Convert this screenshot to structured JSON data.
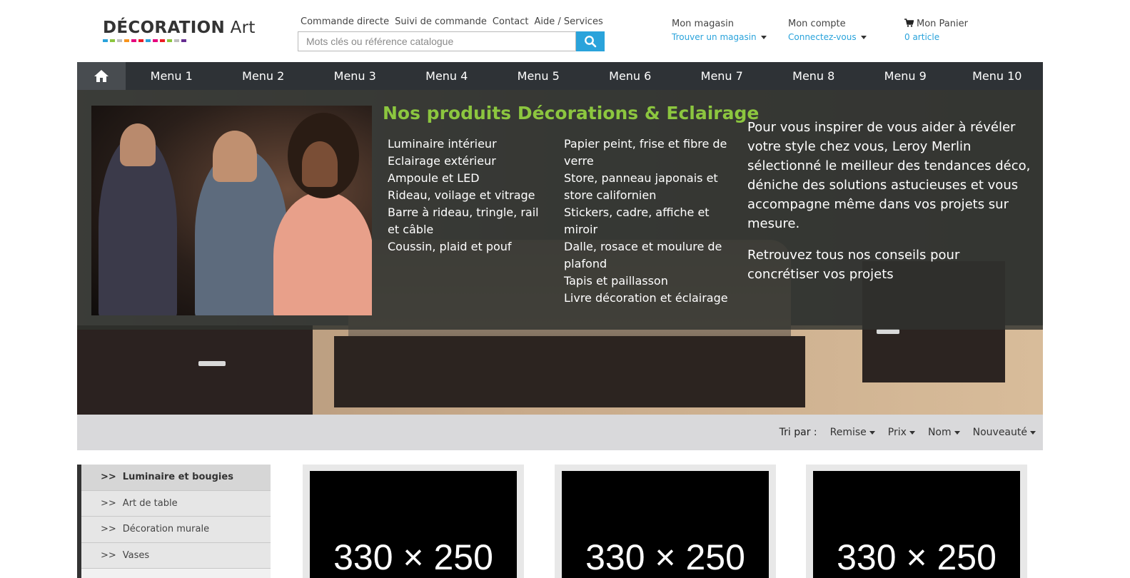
{
  "logo": {
    "brand": "DÉCORATION",
    "suffix": "Art",
    "bar_colors": [
      "#2aa3db",
      "#8cc63f",
      "#bfbfbf",
      "#f7941d",
      "#e6007e",
      "#ec1c24",
      "#2aa3db",
      "#e6007e",
      "#ec1c24",
      "#8cc63f",
      "#bfbfbf",
      "#662d91"
    ]
  },
  "toplinks": [
    "Commande directe",
    "Suivi de commande",
    "Contact",
    "Aide / Services"
  ],
  "search": {
    "placeholder": "Mots clés ou référence catalogue",
    "button_icon": "search-icon"
  },
  "header": {
    "store": {
      "title": "Mon magasin",
      "link": "Trouver un magasin"
    },
    "account": {
      "title": "Mon compte",
      "link": "Connectez-vous"
    },
    "cart": {
      "title": "Mon Panier",
      "count": "0 article",
      "icon": "cart-icon"
    }
  },
  "nav": {
    "home_icon": "home-icon",
    "items": [
      "Menu 1",
      "Menu 2",
      "Menu 3",
      "Menu 4",
      "Menu 5",
      "Menu 6",
      "Menu 7",
      "Menu 8",
      "Menu 9",
      "Menu 10"
    ]
  },
  "hero": {
    "heading": "Nos produits Décorations & Eclairage",
    "col1": [
      "Luminaire intérieur",
      "Eclairage extérieur",
      "Ampoule et LED",
      "Rideau, voilage et vitrage",
      "Barre à rideau, tringle, rail et câble",
      "Coussin, plaid et pouf"
    ],
    "col2": [
      "Papier peint, frise et fibre de verre",
      "Store, panneau japonais et store californien",
      "Stickers, cadre, affiche et miroir",
      "Dalle, rosace et moulure de plafond",
      "Tapis et paillasson",
      "Livre décoration et éclairage"
    ],
    "para1": "Pour vous inspirer de vous aider à révéler votre style chez vous, Leroy Merlin sélectionné le meilleur des tendances déco, déniche des solutions astucieuses et vous accompagne même dans vos projets sur mesure.",
    "para2": "Retrouvez tous nos conseils pour concrétiser vos projets",
    "accent_color": "#8cc63f"
  },
  "sort": {
    "label": "Tri par :",
    "options": [
      "Remise",
      "Prix",
      "Nom",
      "Nouveauté"
    ]
  },
  "sidebar": {
    "arrow": ">>",
    "items": [
      "Luminaire et bougies",
      "Art de table",
      "Décoration murale",
      "Vases"
    ]
  },
  "products": [
    {
      "image_label": "330 × 250"
    },
    {
      "image_label": "330 × 250"
    },
    {
      "image_label": "330 × 250"
    }
  ]
}
